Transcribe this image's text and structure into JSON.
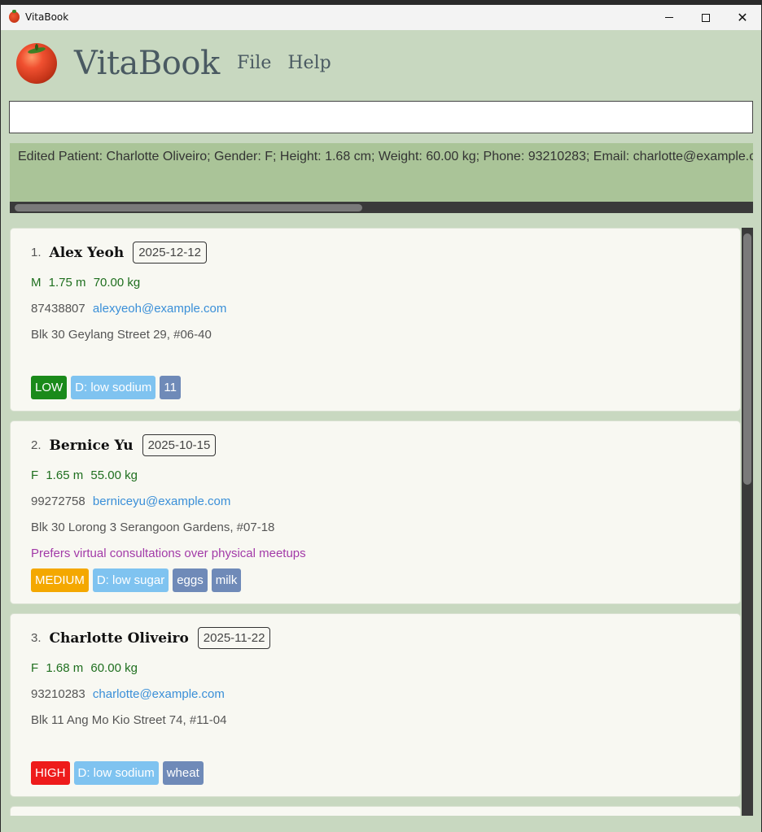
{
  "window": {
    "title": "VitaBook"
  },
  "header": {
    "app_name": "VitaBook",
    "menu": {
      "file": "File",
      "help": "Help"
    }
  },
  "command": {
    "value": ""
  },
  "result": {
    "text": "Edited Patient: Charlotte Oliveiro; Gender: F; Height: 1.68 cm; Weight: 60.00 kg; Phone: 93210283; Email: charlotte@example.c"
  },
  "patients": [
    {
      "index": "1.",
      "name": "Alex Yeoh",
      "date": "2025-12-12",
      "gender": "M",
      "height": "1.75 m",
      "weight": "70.00 kg",
      "phone": "87438807",
      "email": "alexyeoh@example.com",
      "address": "Blk 30 Geylang Street 29, #06-40",
      "note": "",
      "priority": "LOW",
      "diet": "D: low sodium",
      "allergies": [
        "11"
      ]
    },
    {
      "index": "2.",
      "name": "Bernice Yu",
      "date": "2025-10-15",
      "gender": "F",
      "height": "1.65 m",
      "weight": "55.00 kg",
      "phone": "99272758",
      "email": "berniceyu@example.com",
      "address": "Blk 30 Lorong 3 Serangoon Gardens, #07-18",
      "note": "Prefers virtual consultations over physical meetups",
      "priority": "MEDIUM",
      "diet": "D: low sugar",
      "allergies": [
        "eggs",
        "milk"
      ]
    },
    {
      "index": "3.",
      "name": "Charlotte Oliveiro",
      "date": "2025-11-22",
      "gender": "F",
      "height": "1.68 m",
      "weight": "60.00 kg",
      "phone": "93210283",
      "email": "charlotte@example.com",
      "address": "Blk 11 Ang Mo Kio Street 74, #11-04",
      "note": "",
      "priority": "HIGH",
      "diet": "D: low sodium",
      "allergies": [
        "wheat"
      ]
    }
  ],
  "colors": {
    "background": "#c8d8c0",
    "result_bg": "#aac498",
    "low": "#1a8a1a",
    "medium": "#f4a800",
    "high": "#ee1b1b",
    "diet": "#7fc3f0",
    "allergy": "#6f8ab8",
    "email": "#3a8fd8",
    "note": "#a23aa8"
  }
}
